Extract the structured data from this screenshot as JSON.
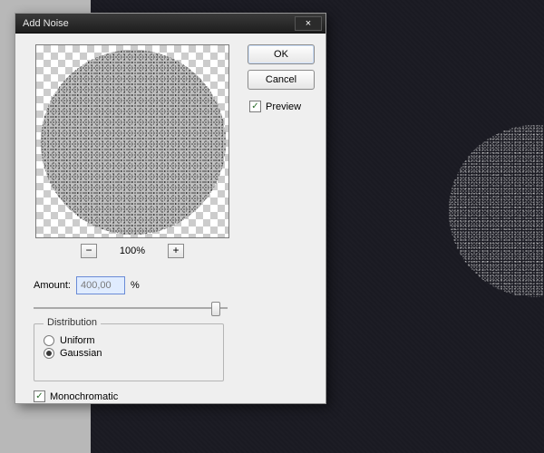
{
  "dialog": {
    "title": "Add Noise",
    "close_glyph": "×",
    "buttons": {
      "ok": "OK",
      "cancel": "Cancel"
    },
    "preview": {
      "label": "Preview",
      "checked": true
    },
    "zoom": {
      "minus": "−",
      "plus": "+",
      "value": "100%"
    },
    "amount": {
      "label": "Amount:",
      "value": "400,00",
      "unit": "%",
      "slider_pos": 0.96
    },
    "distribution": {
      "legend": "Distribution",
      "options": [
        {
          "label": "Uniform",
          "selected": false
        },
        {
          "label": "Gaussian",
          "selected": true
        }
      ]
    },
    "monochromatic": {
      "label": "Monochromatic",
      "checked": true
    }
  }
}
